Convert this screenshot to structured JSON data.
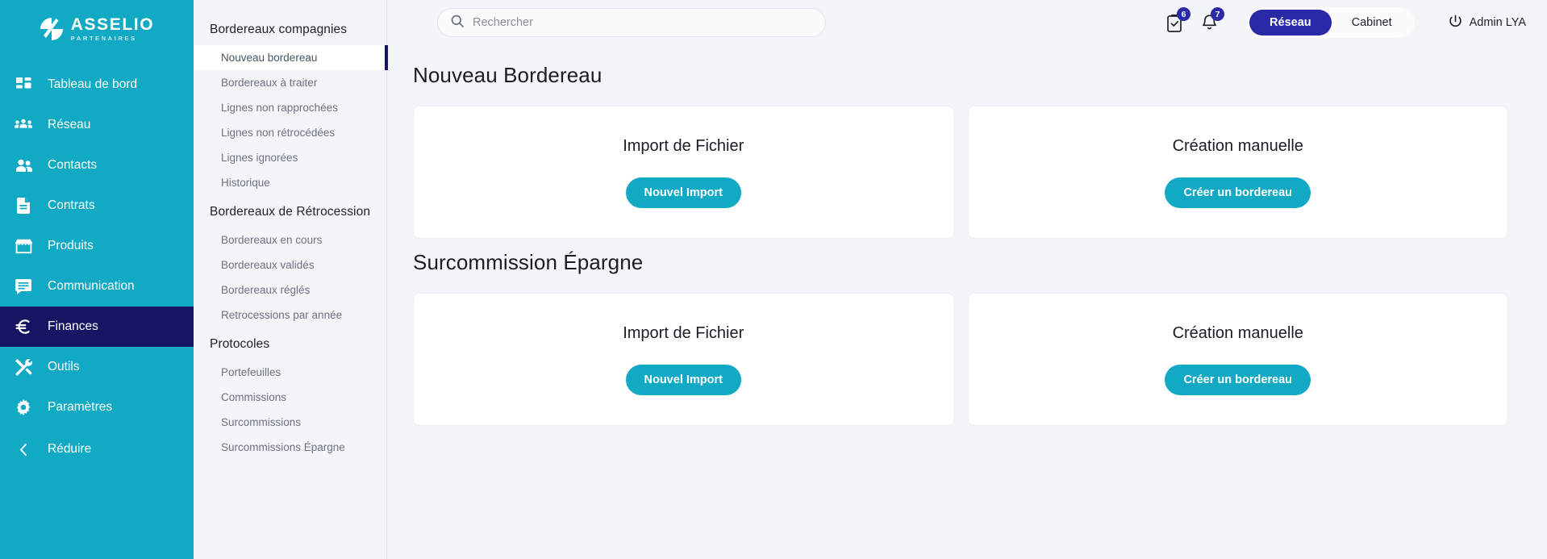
{
  "brand": {
    "name": "ASSELIO",
    "tagline": "PARTENAIRES",
    "teal": "#12a9c4",
    "navy": "#151563",
    "accent_indigo": "#2a2aa8"
  },
  "sidebar": {
    "items": [
      {
        "label": "Tableau de bord",
        "icon": "dashboard-grid-icon",
        "active": false
      },
      {
        "label": "Réseau",
        "icon": "network-people-icon",
        "active": false
      },
      {
        "label": "Contacts",
        "icon": "contacts-people-icon",
        "active": false
      },
      {
        "label": "Contrats",
        "icon": "document-icon",
        "active": false
      },
      {
        "label": "Produits",
        "icon": "store-icon",
        "active": false
      },
      {
        "label": "Communication",
        "icon": "message-icon",
        "active": false
      },
      {
        "label": "Finances",
        "icon": "euro-icon",
        "active": true
      },
      {
        "label": "Outils",
        "icon": "tools-icon",
        "active": false
      },
      {
        "label": "Paramètres",
        "icon": "gear-icon",
        "active": false
      },
      {
        "label": "Réduire",
        "icon": "chevron-left-icon",
        "active": false
      }
    ]
  },
  "subpanel": {
    "groups": [
      {
        "title": "Bordereaux compagnies",
        "items": [
          {
            "label": "Nouveau bordereau",
            "active": true
          },
          {
            "label": "Bordereaux à traiter",
            "active": false
          },
          {
            "label": "Lignes non rapprochées",
            "active": false
          },
          {
            "label": "Lignes non rétrocédées",
            "active": false
          },
          {
            "label": "Lignes ignorées",
            "active": false
          },
          {
            "label": "Historique",
            "active": false
          }
        ]
      },
      {
        "title": "Bordereaux de Rétrocession",
        "items": [
          {
            "label": "Bordereaux en cours",
            "active": false
          },
          {
            "label": "Bordereaux validés",
            "active": false
          },
          {
            "label": "Bordereaux réglés",
            "active": false
          },
          {
            "label": "Retrocessions par année",
            "active": false
          }
        ]
      },
      {
        "title": "Protocoles",
        "items": [
          {
            "label": "Portefeuilles",
            "active": false
          },
          {
            "label": "Commissions",
            "active": false
          },
          {
            "label": "Surcommissions",
            "active": false
          },
          {
            "label": "Surcommissions Épargne",
            "active": false
          }
        ]
      }
    ]
  },
  "header": {
    "search": {
      "placeholder": "Rechercher",
      "value": ""
    },
    "tasks_badge": "6",
    "notifications_badge": "7",
    "segments": [
      {
        "label": "Réseau",
        "active": true
      },
      {
        "label": "Cabinet",
        "active": false
      }
    ],
    "user": "Admin LYA"
  },
  "main": {
    "sections": [
      {
        "title": "Nouveau Bordereau",
        "cards": [
          {
            "title": "Import de Fichier",
            "button": "Nouvel Import"
          },
          {
            "title": "Création manuelle",
            "button": "Créer un bordereau"
          }
        ]
      },
      {
        "title": "Surcommission Épargne",
        "cards": [
          {
            "title": "Import de Fichier",
            "button": "Nouvel Import"
          },
          {
            "title": "Création manuelle",
            "button": "Créer un bordereau"
          }
        ]
      }
    ]
  }
}
